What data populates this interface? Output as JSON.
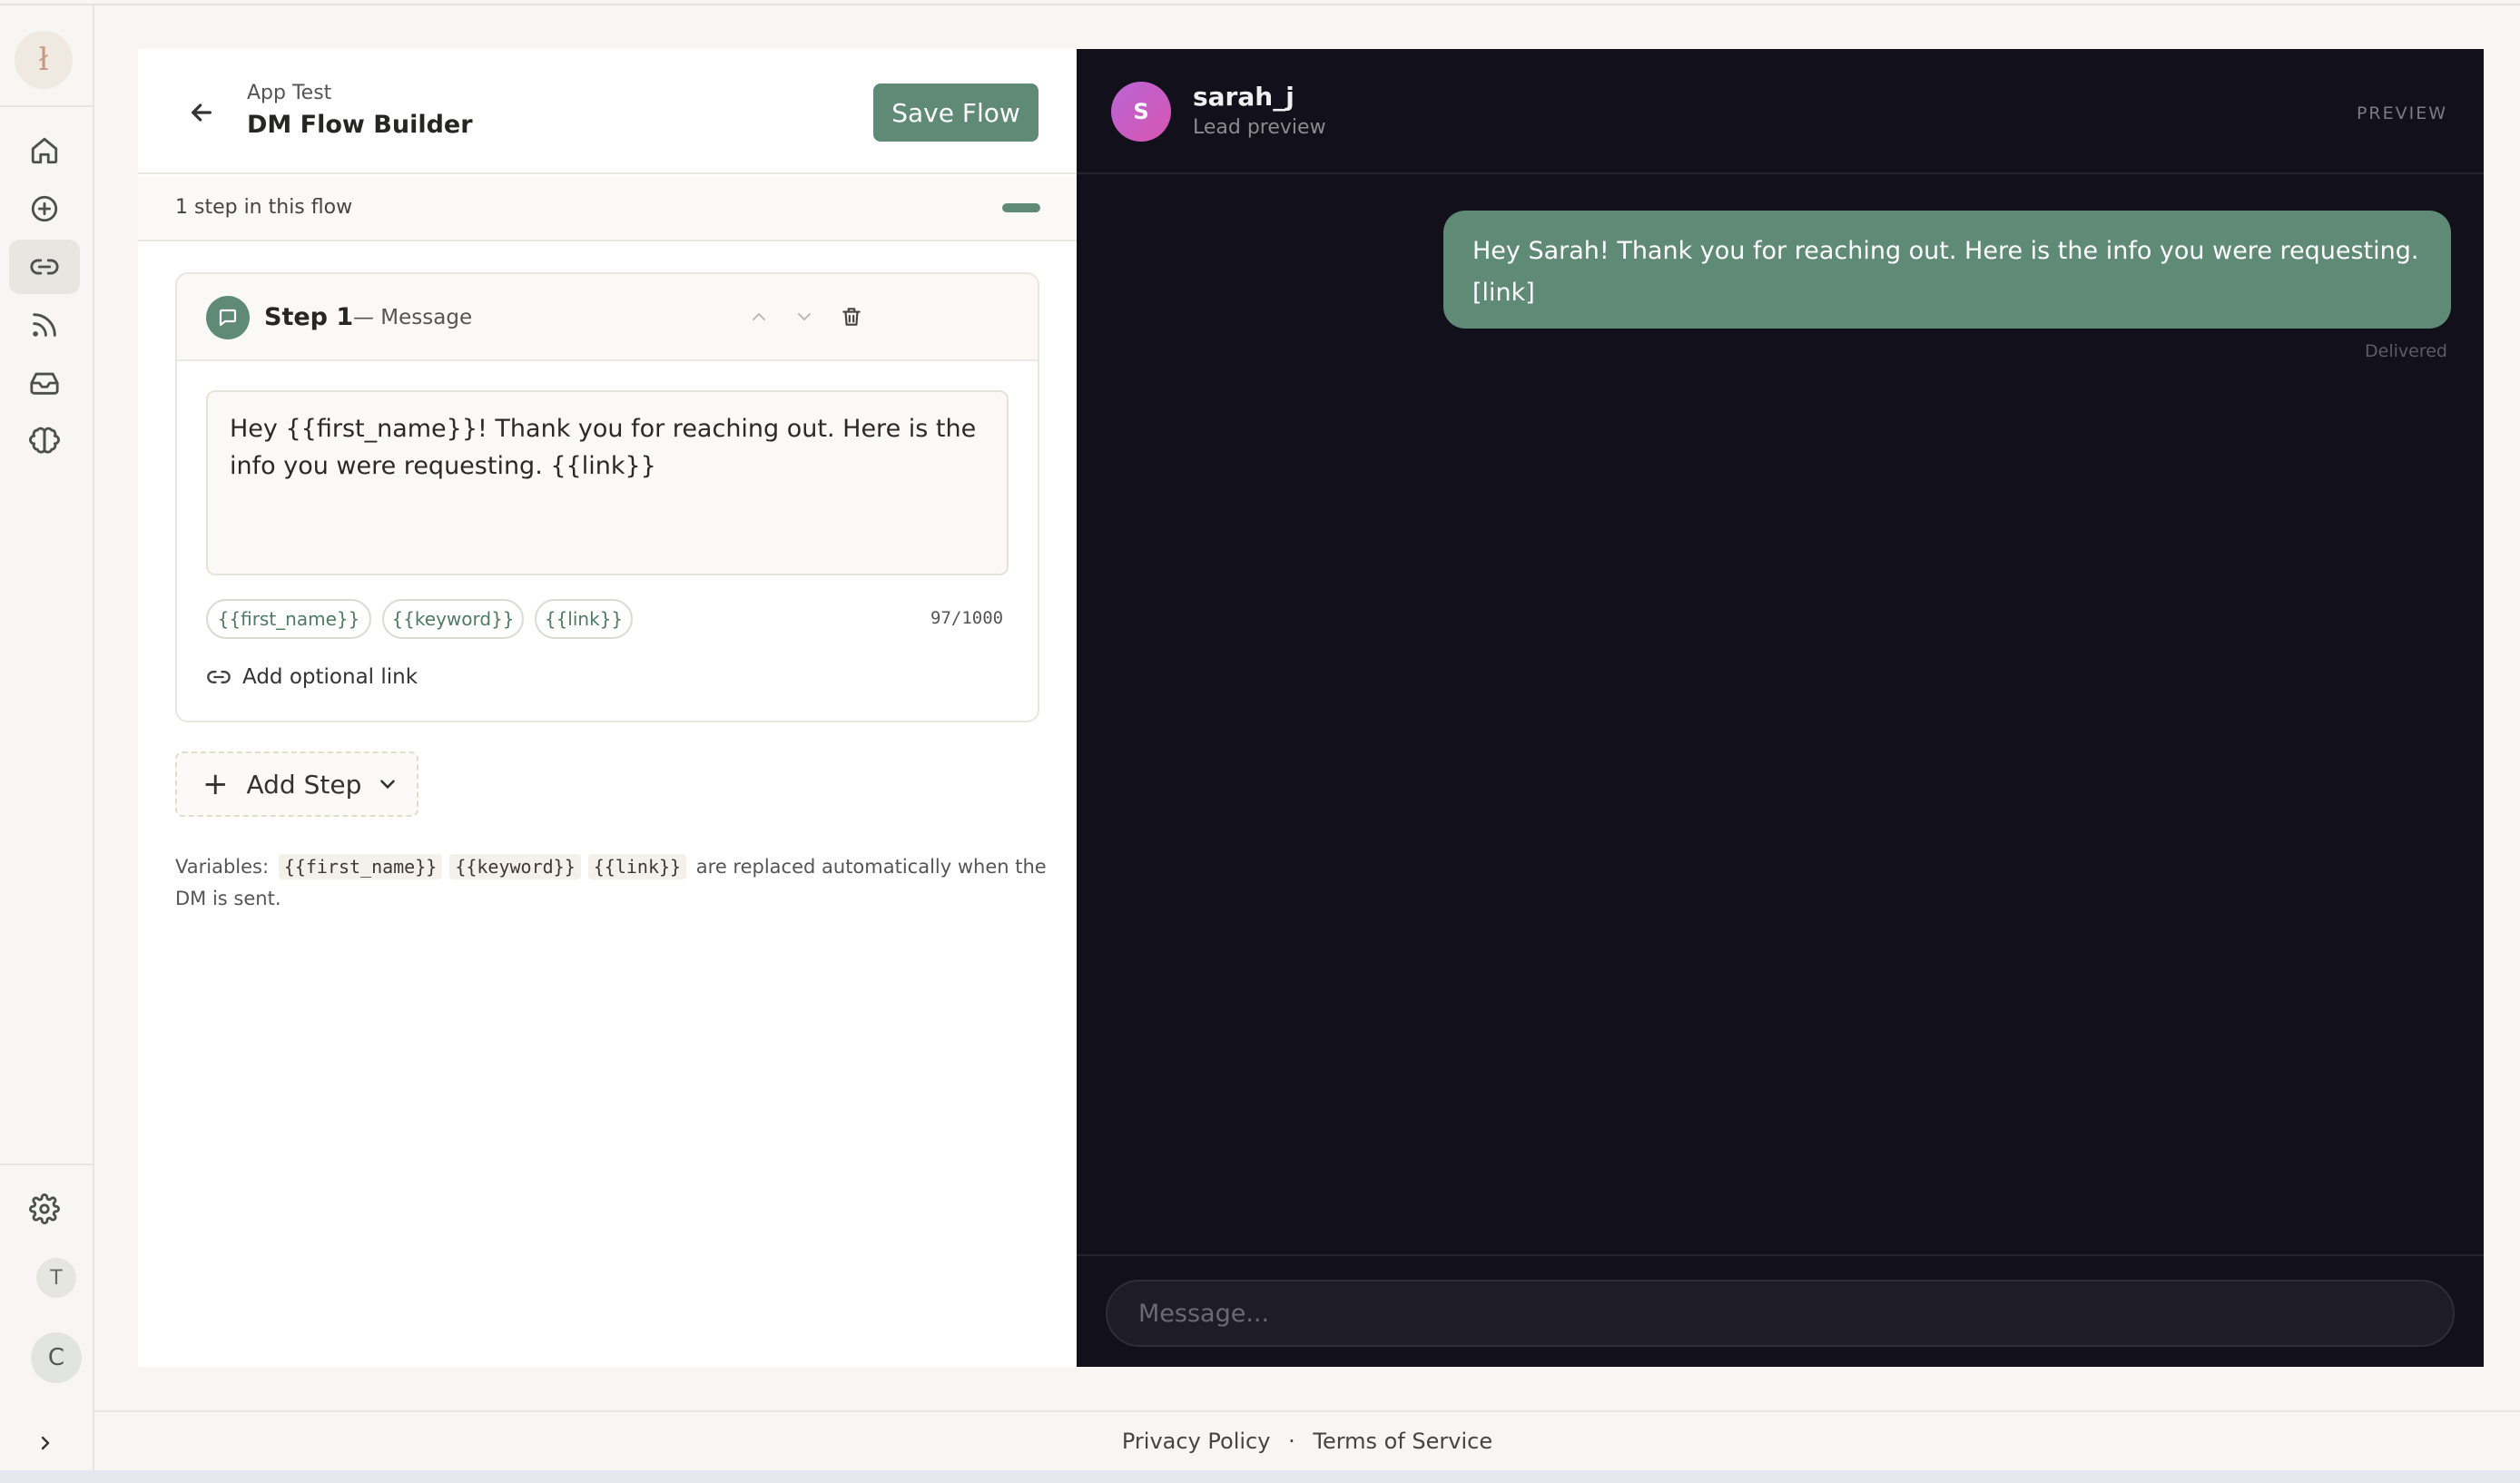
{
  "rail": {
    "logo_glyph": "ł",
    "items": [
      {
        "name": "home-icon"
      },
      {
        "name": "plus-circle-icon"
      },
      {
        "name": "link-icon",
        "active": true
      },
      {
        "name": "rss-icon"
      },
      {
        "name": "inbox-icon"
      },
      {
        "name": "brain-icon"
      }
    ],
    "settings_icon": "gear-icon",
    "user_initial_t": "T",
    "user_initial_c": "C"
  },
  "builder": {
    "breadcrumb": "App Test",
    "title": "DM Flow Builder",
    "save_label": "Save Flow",
    "steps_count": "1 step in this flow",
    "step": {
      "title": "Step 1",
      "type": "— Message",
      "message": "Hey {{first_name}}!  Thank you for reaching out.  Here is the info you were requesting.  {{link}}",
      "chips": [
        "{{first_name}}",
        "{{keyword}}",
        "{{link}}"
      ],
      "counter": "97/1000",
      "optional_link_label": "Add optional link"
    },
    "add_step_label": "Add Step",
    "vars_prefix": "Variables:",
    "vars": [
      "{{first_name}}",
      "{{keyword}}",
      "{{link}}"
    ],
    "vars_suffix": "are replaced automatically when the DM is sent."
  },
  "preview": {
    "avatar_initial": "S",
    "username": "sarah_j",
    "subtitle": "Lead preview",
    "label": "PREVIEW",
    "bubble_text": "Hey Sarah!  Thank you for reaching out.  Here is the info you were requesting.  [link]",
    "status": "Delivered",
    "input_placeholder": "Message..."
  },
  "footer": {
    "privacy": "Privacy Policy",
    "separator": "·",
    "terms": "Terms of Service"
  },
  "colors": {
    "accent": "#5e8a76",
    "preview_bg": "#12111b",
    "page_bg": "#f8f6f2"
  }
}
